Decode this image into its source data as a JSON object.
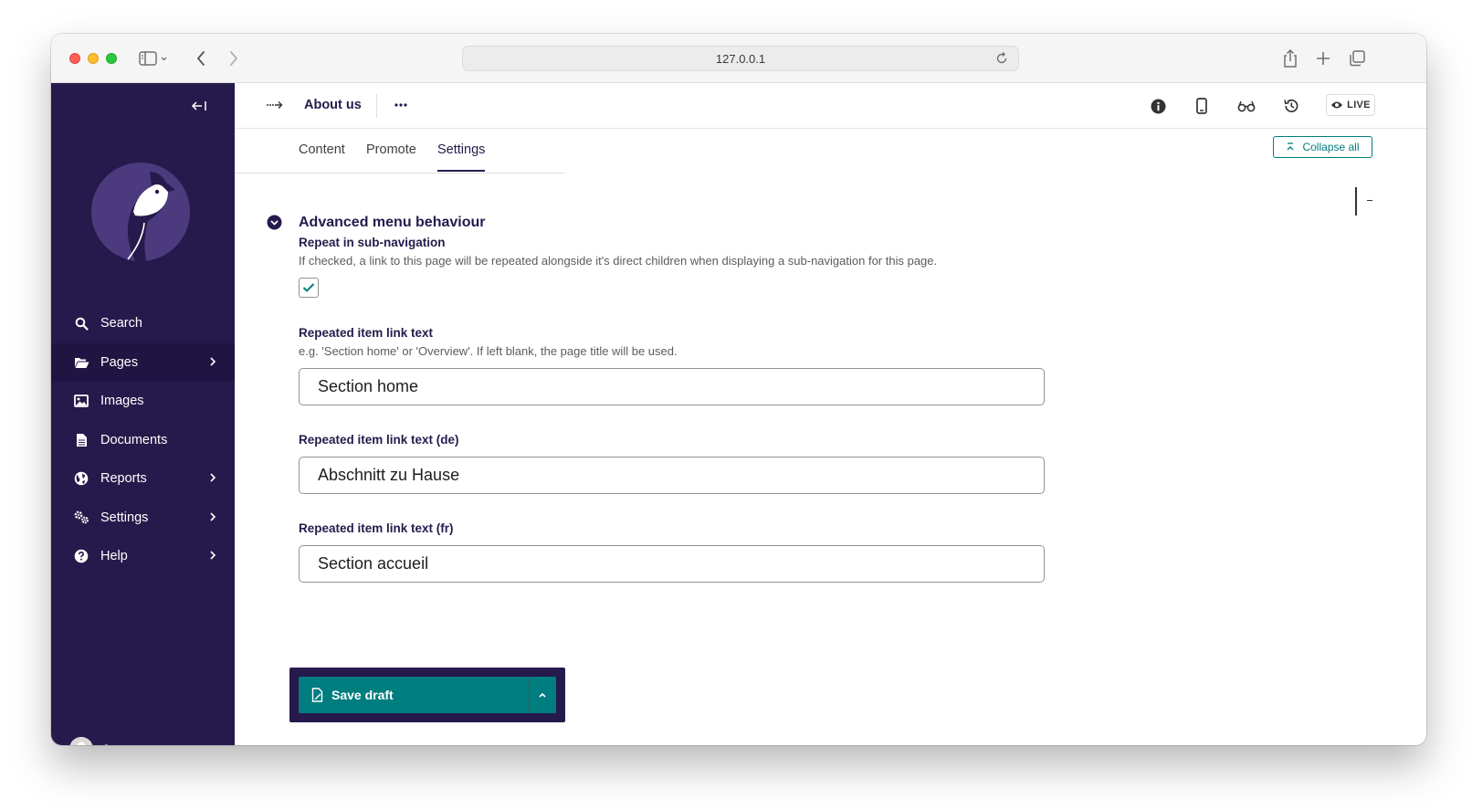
{
  "browser": {
    "url": "127.0.0.1"
  },
  "sidebar": {
    "items": [
      {
        "label": "Search",
        "icon": "search-icon",
        "has_submenu": false
      },
      {
        "label": "Pages",
        "icon": "folder-open-icon",
        "has_submenu": true,
        "active": true
      },
      {
        "label": "Images",
        "icon": "image-icon",
        "has_submenu": false
      },
      {
        "label": "Documents",
        "icon": "document-icon",
        "has_submenu": false
      },
      {
        "label": "Reports",
        "icon": "globe-icon",
        "has_submenu": true
      },
      {
        "label": "Settings",
        "icon": "cogs-icon",
        "has_submenu": true
      },
      {
        "label": "Help",
        "icon": "help-icon",
        "has_submenu": true
      }
    ],
    "user": {
      "name": "Jo"
    }
  },
  "header": {
    "title": "About us",
    "live_label": "LIVE"
  },
  "tabs": [
    {
      "label": "Content",
      "active": false
    },
    {
      "label": "Promote",
      "active": false
    },
    {
      "label": "Settings",
      "active": true
    }
  ],
  "collapse_all_label": "Collapse all",
  "section": {
    "title": "Advanced menu behaviour",
    "repeat": {
      "label": "Repeat in sub-navigation",
      "help": "If checked, a link to this page will be repeated alongside it's direct children when displaying a sub-navigation for this page.",
      "checked": true
    },
    "link_text": {
      "label": "Repeated item link text",
      "help": "e.g. 'Section home' or 'Overview'. If left blank, the page title will be used.",
      "value": "Section home"
    },
    "link_text_de": {
      "label": "Repeated item link text (de)",
      "value": "Abschnitt zu Hause"
    },
    "link_text_fr": {
      "label": "Repeated item link text (fr)",
      "value": "Section accueil"
    }
  },
  "footer": {
    "save_label": "Save draft"
  },
  "colors": {
    "sidebar_bg": "#261a4c",
    "accent_teal": "#007d7e",
    "heading": "#261a4c"
  }
}
